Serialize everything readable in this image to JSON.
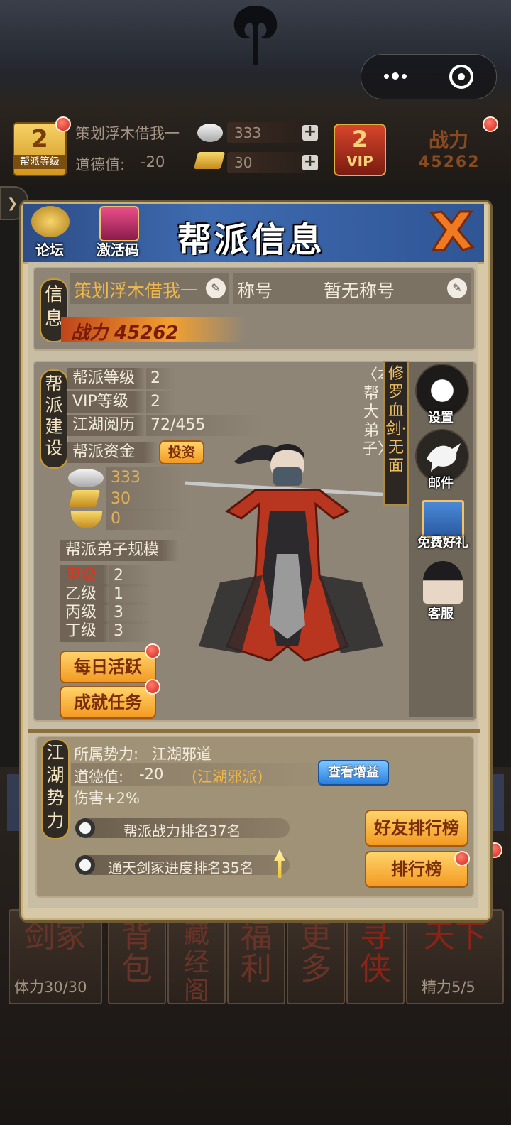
{
  "capsule": {
    "menu_icon": "more-dots-icon",
    "close_icon": "target-circle-icon"
  },
  "status": {
    "guild_level": "2",
    "guild_level_label": "帮派等级",
    "player_name": "策划浮木借我一",
    "morality_label": "道德值:",
    "morality_value": "-20",
    "silver": "333",
    "gold": "30",
    "vip_level": "2",
    "vip_label": "VIP",
    "power_label": "战力",
    "power_value": "45262"
  },
  "panel": {
    "title": "帮派信息",
    "forum_label": "论坛",
    "activation_label": "激活码",
    "info_tag": "信息",
    "name": "策划浮木借我一",
    "title_label": "称号",
    "title_value": "暂无称号",
    "power_text": "战力 45262",
    "build_tag": "帮派建设",
    "rows": [
      {
        "label": "帮派等级",
        "value": "2"
      },
      {
        "label": "VIP等级",
        "value": "2"
      },
      {
        "label": "江湖阅历",
        "value": "72/455"
      }
    ],
    "funds_label": "帮派资金",
    "invest_label": "投资",
    "currencies": [
      {
        "icon": "silver-ingot-icon",
        "value": "333"
      },
      {
        "icon": "gold-bar-icon",
        "value": "30"
      },
      {
        "icon": "gold-yuanbao-icon",
        "value": "0"
      }
    ],
    "disciple_scale_label": "帮派弟子规模",
    "grades": [
      {
        "label": "甲级",
        "value": "2",
        "highlight": true
      },
      {
        "label": "乙级",
        "value": "1"
      },
      {
        "label": "丙级",
        "value": "3"
      },
      {
        "label": "丁级",
        "value": "3"
      }
    ],
    "daily_active": "每日活跃",
    "achievement": "成就任务",
    "disciple_caption": "〈本帮大弟子〉",
    "disciple_name": "修罗血剑·无面",
    "side": {
      "settings": "设置",
      "mail": "邮件",
      "gift": "免费好礼",
      "service": "客服"
    },
    "faction_tag": "江湖势力",
    "faction_label": "所属势力:",
    "faction_value": "江湖邪道",
    "morality_label": "道德值:",
    "morality_value": "-20",
    "morality_note": "(江湖邪派)",
    "buff_button": "查看增益",
    "damage": "伤害+2%",
    "rank_power": "帮派战力排名37名",
    "rank_sword": "通天剑冢进度排名35名",
    "friend_rank": "好友排行榜",
    "rank": "排行榜"
  },
  "bottom": {
    "tiles": [
      "剑冢",
      "背包",
      "藏经阁",
      "福利",
      "更多",
      "寻侠",
      "天下"
    ],
    "stamina": "体力30/30",
    "energy": "精力5/5"
  }
}
